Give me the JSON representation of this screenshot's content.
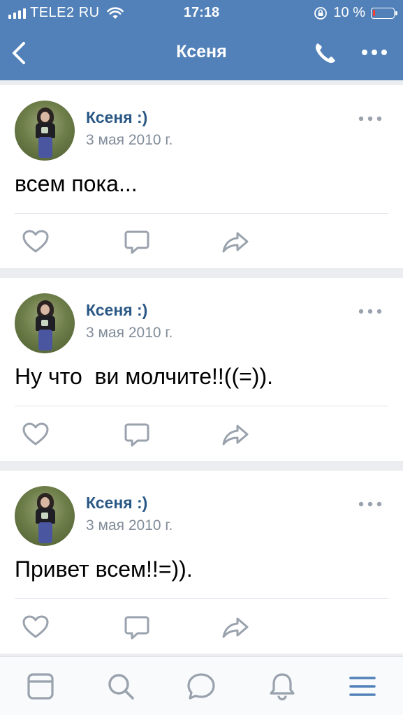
{
  "status_bar": {
    "carrier": "TELE2 RU",
    "time": "17:18",
    "battery_percent": "10 %",
    "battery_level": 0.1
  },
  "nav": {
    "title": "Ксеня",
    "icons": [
      "back-chevron-icon",
      "phone-icon",
      "more-dots-icon"
    ]
  },
  "posts": [
    {
      "author": "Ксеня :)",
      "date": "3 мая 2010 г.",
      "text": "всем пока..."
    },
    {
      "author": "Ксеня :)",
      "date": "3 мая 2010 г.",
      "text": "Ну что  ви молчите!!((=))."
    },
    {
      "author": "Ксеня :)",
      "date": "3 мая 2010 г.",
      "text": "Привет всем!!=))."
    }
  ],
  "post_actions": [
    "heart-icon",
    "comment-icon",
    "share-icon"
  ],
  "tab_bar": {
    "tabs": [
      "news-icon",
      "search-icon",
      "messages-icon",
      "notifications-icon",
      "menu-icon"
    ],
    "active": "menu-icon"
  },
  "colors": {
    "header": "#5181b8",
    "author": "#2a5885",
    "secondary": "#818c99",
    "icon": "#99a2ad",
    "active_tab": "#5181b8",
    "background": "#ebedf0"
  }
}
